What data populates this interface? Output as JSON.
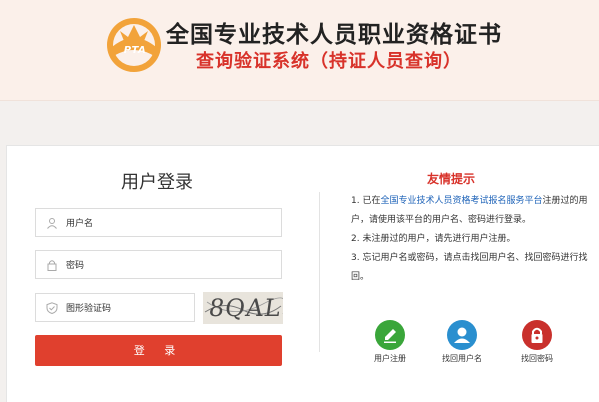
{
  "header": {
    "logo_text": "PTA",
    "title": "全国专业技术人员职业资格证书",
    "subtitle": "查询验证系统（持证人员查询）"
  },
  "login": {
    "title": "用户登录",
    "username_placeholder": "用户名",
    "password_placeholder": "密码",
    "captcha_placeholder": "图形验证码",
    "captcha_text": "8QAL",
    "submit_label": "登 录"
  },
  "tips": {
    "title": "友情提示",
    "line1_prefix": "1. 已在",
    "line1_link": "全国专业技术人员资格考试报名服务平台",
    "line1_suffix": "注册过的用户，请使用该平台的用户名、密码进行登录。",
    "line2": "2. 未注册过的用户，请先进行用户注册。",
    "line3": "3. 忘记用户名或密码，请点击找回用户名、找回密码进行找回。"
  },
  "actions": [
    {
      "label": "用户注册",
      "icon": "pencil-icon",
      "color": "#3aa63a"
    },
    {
      "label": "找回用户名",
      "icon": "user-icon",
      "color": "#2a8fcf"
    },
    {
      "label": "找回密码",
      "icon": "lock-icon",
      "color": "#c9302c"
    }
  ]
}
